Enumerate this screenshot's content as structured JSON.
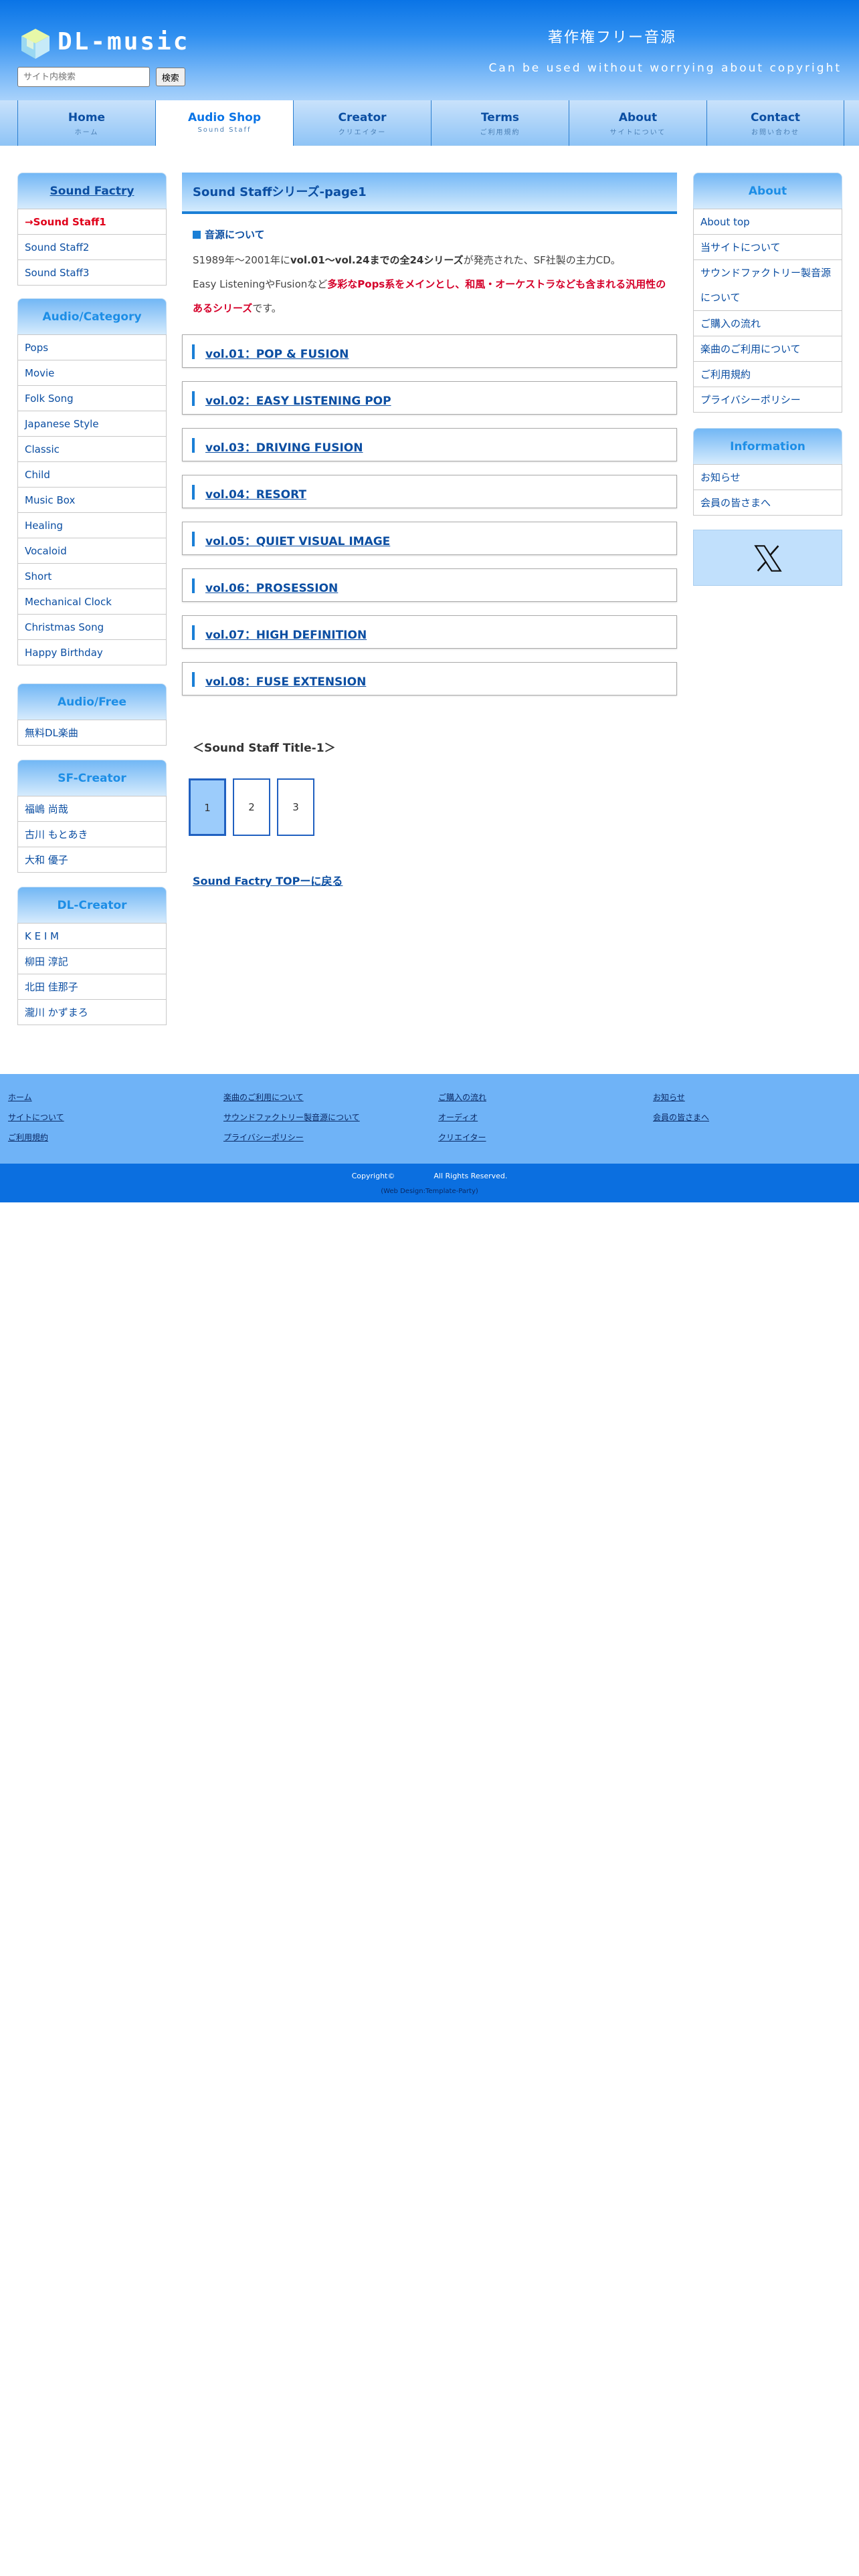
{
  "header": {
    "logo_text": "DL-music",
    "search_placeholder": "サイト内検索",
    "search_button": "検索",
    "tagline_jp": "著作権フリー音源",
    "tagline_en": "Can be used without worrying about copyright"
  },
  "nav": [
    {
      "label": "Home",
      "sub": "ホーム"
    },
    {
      "label": "Audio Shop",
      "sub": "Sound Staff"
    },
    {
      "label": "Creator",
      "sub": "クリエイター"
    },
    {
      "label": "Terms",
      "sub": "ご利用規約"
    },
    {
      "label": "About",
      "sub": "サイトについて"
    },
    {
      "label": "Contact",
      "sub": "お問い合わせ"
    }
  ],
  "left": {
    "sound_factory": {
      "title": "Sound Factry",
      "items": [
        "→Sound Staff1",
        "Sound Staff2",
        "Sound Staff3"
      ]
    },
    "category": {
      "title": "Audio/Category",
      "items": [
        "Pops",
        "Movie",
        "Folk Song",
        "Japanese Style",
        "Classic",
        "Child",
        "Music Box",
        "Healing",
        "Vocaloid",
        "Short",
        "Mechanical Clock",
        "Christmas Song",
        "Happy Birthday"
      ]
    },
    "free": {
      "title": "Audio/Free",
      "items": [
        "無料DL楽曲"
      ]
    },
    "sf_creator": {
      "title": "SF-Creator",
      "items": [
        "福嶋 尚哉",
        "古川 もとあき",
        "大和 優子"
      ]
    },
    "dl_creator": {
      "title": "DL-Creator",
      "items": [
        "K E I M",
        "柳田 淳記",
        "北田 佳那子",
        "瀧川 かずまろ"
      ]
    }
  },
  "main": {
    "title": "Sound Staffシリーズ-page1",
    "source_heading": "音源について",
    "para1_a": "S1989年～2001年に",
    "para1_b": "vol.01〜vol.24までの全24シリーズ",
    "para1_c": "が発売された、SF社製の主力CD。",
    "para2_a": "Easy ListeningやFusionなど",
    "para2_red1": "多彩なPops系をメインとし、和風・オーケストラなども含まれる汎用性の",
    "para2_red2": "あるシリーズ",
    "para2_end": "です。",
    "volumes": [
      "vol.01：POP & FUSION",
      "vol.02：EASY LISTENING POP",
      "vol.03：DRIVING FUSION",
      "vol.04：RESORT",
      "vol.05：QUIET VISUAL IMAGE",
      "vol.06：PROSESSION",
      "vol.07：HIGH DEFINITION",
      "vol.08：FUSE EXTENSION"
    ],
    "title_1": "＜Sound Staff Title-1＞",
    "pages": [
      "1",
      "2",
      "3"
    ],
    "back_link": "Sound Factry TOPーに戻る"
  },
  "right": {
    "about": {
      "title": "About",
      "items": [
        "About top",
        "当サイトについて",
        "サウンドファクトリー製音源",
        "について",
        "ご購入の流れ",
        "楽曲のご利用について",
        "ご利用規約",
        "プライバシーポリシー"
      ]
    },
    "information": {
      "title": "Information",
      "items": [
        "お知らせ",
        "会員の皆さまへ"
      ]
    },
    "sns_icon": "x-logo"
  },
  "footer": {
    "col1": [
      "ホーム",
      "サイトについて",
      "ご利用規約"
    ],
    "col2": [
      "楽曲のご利用について",
      "サウンドファクトリー製音源について",
      "プライバシーポリシー"
    ],
    "col3": [
      "ご購入の流れ",
      "オーディオ",
      "クリエイター"
    ],
    "col4": [
      "お知らせ",
      "会員の皆さまへ"
    ],
    "copyright_prefix": "Copyright©",
    "copyright_suffix": "All Rights Reserved.",
    "credit": "(Web Design:Template-Party)"
  },
  "colors": {
    "accent": "#1a7fd6",
    "nav_text": "#0b4ea2",
    "highlight_red": "#d5002a",
    "footer_bg": "#6fb3f7"
  }
}
